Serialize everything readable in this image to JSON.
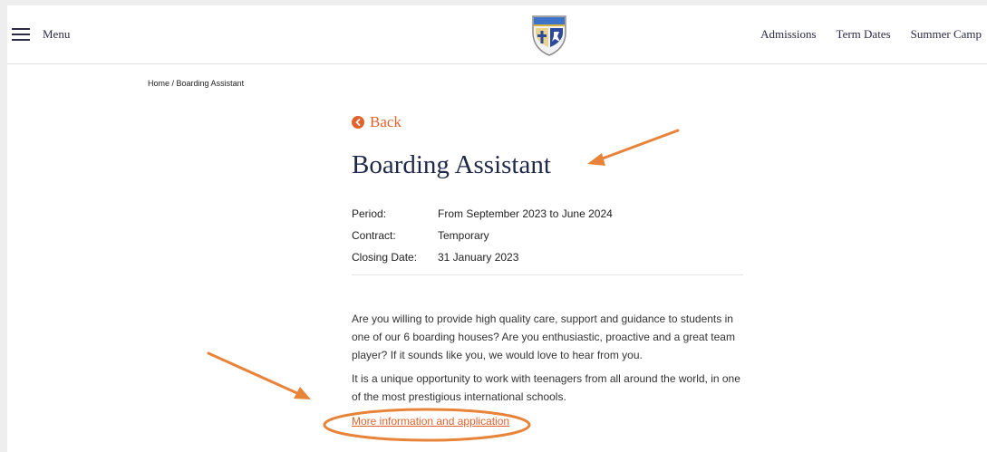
{
  "header": {
    "menu_label": "Menu",
    "nav": [
      "Admissions",
      "Term Dates",
      "Summer Camp"
    ]
  },
  "breadcrumb": {
    "home": "Home",
    "separator": " / ",
    "current": "Boarding Assistant"
  },
  "back_label": "Back",
  "title": "Boarding Assistant",
  "details": [
    {
      "label": "Period:",
      "value": "From September 2023 to June 2024"
    },
    {
      "label": "Contract:",
      "value": "Temporary"
    },
    {
      "label": "Closing Date:",
      "value": "31 January 2023"
    }
  ],
  "paragraphs": [
    "Are you willing to provide high quality care, support and guidance to students in one of our 6 boarding houses? Are you enthusiastic, proactive and a great team player? If it sounds like you, we would love to hear from you.",
    "It is a unique opportunity to work with teenagers from all around the world, in one of the most prestigious international schools."
  ],
  "more_link": "More information and application",
  "colors": {
    "accent": "#e2622b",
    "navy": "#1f2849",
    "annotation": "#e8833a"
  },
  "icons": {
    "menu": "hamburger-icon",
    "back": "chevron-left-circle-icon",
    "logo": "school-crest-logo"
  }
}
